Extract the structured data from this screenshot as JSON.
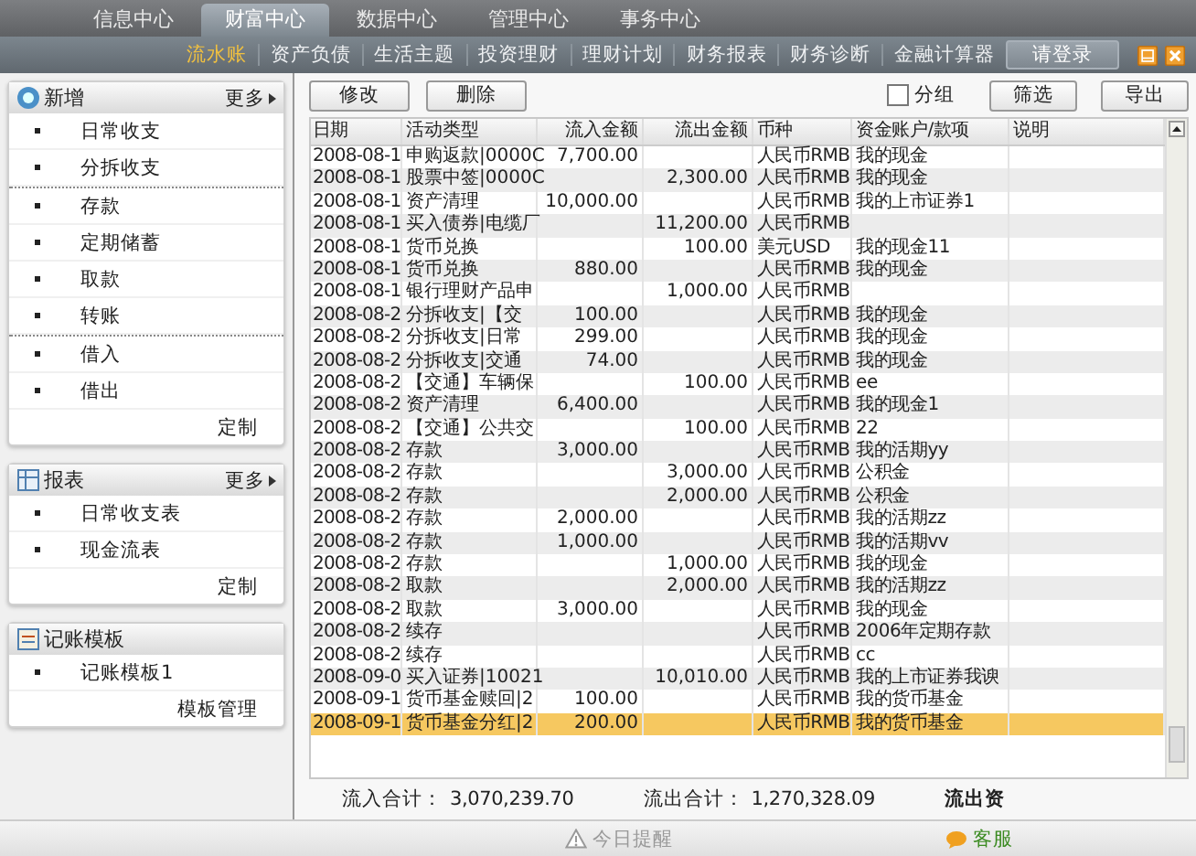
{
  "top_tabs": [
    {
      "label": "信息中心",
      "selected": false
    },
    {
      "label": "财富中心",
      "selected": true
    },
    {
      "label": "数据中心",
      "selected": false
    },
    {
      "label": "管理中心",
      "selected": false
    },
    {
      "label": "事务中心",
      "selected": false
    }
  ],
  "nav": [
    {
      "label": "流水账",
      "selected": true
    },
    {
      "label": "资产负债",
      "selected": false
    },
    {
      "label": "生活主题",
      "selected": false
    },
    {
      "label": "投资理财",
      "selected": false
    },
    {
      "label": "理财计划",
      "selected": false
    },
    {
      "label": "财务报表",
      "selected": false
    },
    {
      "label": "财务诊断",
      "selected": false
    },
    {
      "label": "金融计算器",
      "selected": false
    }
  ],
  "login_button": "请登录",
  "sidebar": [
    {
      "title": "新增",
      "more": "更多",
      "groups": [
        [
          "日常收支",
          "分拆收支"
        ],
        [
          "存款",
          "定期储蓄",
          "取款",
          "转账"
        ],
        [
          "借入",
          "借出"
        ]
      ],
      "footer": "定制"
    },
    {
      "title": "报表",
      "more": "更多",
      "groups": [
        [
          "日常收支表",
          "现金流表"
        ]
      ],
      "footer": "定制"
    },
    {
      "title": "记账模板",
      "groups": [
        [
          "记账模板1"
        ]
      ],
      "footer": "模板管理"
    }
  ],
  "toolbar": {
    "left_buttons": [
      "修改",
      "删除"
    ],
    "group_checkbox": {
      "label": "分组",
      "checked": false
    },
    "right_buttons": [
      "筛选",
      "导出"
    ]
  },
  "table": {
    "columns": [
      "日期",
      "活动类型",
      "流入金额",
      "流出金额",
      "币种",
      "资金账户/款项",
      "说明"
    ],
    "rows": [
      {
        "cells": [
          "2008-08-1",
          "申购返款|0000C",
          "7,700.00",
          "",
          "人民币RMB",
          "我的现金",
          ""
        ],
        "selected": false
      },
      {
        "cells": [
          "2008-08-1",
          "股票中签|0000C",
          "",
          "2,300.00",
          "人民币RMB",
          "我的现金",
          ""
        ],
        "selected": false
      },
      {
        "cells": [
          "2008-08-1",
          "资产清理",
          "10,000.00",
          "",
          "人民币RMB",
          "我的上市证券1",
          ""
        ],
        "selected": false
      },
      {
        "cells": [
          "2008-08-1",
          "买入债券|电缆厂",
          "",
          "11,200.00",
          "人民币RMB",
          "",
          ""
        ],
        "selected": false
      },
      {
        "cells": [
          "2008-08-1",
          "货币兑换",
          "",
          "100.00",
          "美元USD",
          "我的现金11",
          ""
        ],
        "selected": false
      },
      {
        "cells": [
          "2008-08-1",
          "货币兑换",
          "880.00",
          "",
          "人民币RMB",
          "我的现金",
          ""
        ],
        "selected": false
      },
      {
        "cells": [
          "2008-08-1",
          "银行理财产品申",
          "",
          "1,000.00",
          "人民币RMB",
          "",
          ""
        ],
        "selected": false
      },
      {
        "cells": [
          "2008-08-2",
          "分拆收支|【交",
          "100.00",
          "",
          "人民币RMB",
          "我的现金",
          ""
        ],
        "selected": false
      },
      {
        "cells": [
          "2008-08-2",
          "分拆收支|日常",
          "299.00",
          "",
          "人民币RMB",
          "我的现金",
          ""
        ],
        "selected": false
      },
      {
        "cells": [
          "2008-08-2",
          "分拆收支|交通",
          "74.00",
          "",
          "人民币RMB",
          "我的现金",
          ""
        ],
        "selected": false
      },
      {
        "cells": [
          "2008-08-2",
          "【交通】车辆保",
          "",
          "100.00",
          "人民币RMB",
          "ee",
          ""
        ],
        "selected": false
      },
      {
        "cells": [
          "2008-08-2",
          "资产清理",
          "6,400.00",
          "",
          "人民币RMB",
          "我的现金1",
          ""
        ],
        "selected": false
      },
      {
        "cells": [
          "2008-08-2",
          "【交通】公共交",
          "",
          "100.00",
          "人民币RMB",
          "22",
          ""
        ],
        "selected": false
      },
      {
        "cells": [
          "2008-08-2",
          "存款",
          "3,000.00",
          "",
          "人民币RMB",
          "我的活期yy",
          ""
        ],
        "selected": false
      },
      {
        "cells": [
          "2008-08-2",
          "存款",
          "",
          "3,000.00",
          "人民币RMB",
          "公积金",
          ""
        ],
        "selected": false
      },
      {
        "cells": [
          "2008-08-2",
          "存款",
          "",
          "2,000.00",
          "人民币RMB",
          "公积金",
          ""
        ],
        "selected": false
      },
      {
        "cells": [
          "2008-08-2",
          "存款",
          "2,000.00",
          "",
          "人民币RMB",
          "我的活期zz",
          ""
        ],
        "selected": false
      },
      {
        "cells": [
          "2008-08-2",
          "存款",
          "1,000.00",
          "",
          "人民币RMB",
          "我的活期vv",
          ""
        ],
        "selected": false
      },
      {
        "cells": [
          "2008-08-2",
          "存款",
          "",
          "1,000.00",
          "人民币RMB",
          "我的现金",
          ""
        ],
        "selected": false
      },
      {
        "cells": [
          "2008-08-2",
          "取款",
          "",
          "2,000.00",
          "人民币RMB",
          "我的活期zz",
          ""
        ],
        "selected": false
      },
      {
        "cells": [
          "2008-08-2",
          "取款",
          "3,000.00",
          "",
          "人民币RMB",
          "我的现金",
          ""
        ],
        "selected": false
      },
      {
        "cells": [
          "2008-08-2",
          "续存",
          "",
          "",
          "人民币RMB",
          "2006年定期存款",
          ""
        ],
        "selected": false
      },
      {
        "cells": [
          "2008-08-2",
          "续存",
          "",
          "",
          "人民币RMB",
          "cc",
          ""
        ],
        "selected": false
      },
      {
        "cells": [
          "2008-09-0",
          "买入证券|10021",
          "",
          "10,010.00",
          "人民币RMB",
          "我的上市证券我谀",
          ""
        ],
        "selected": false
      },
      {
        "cells": [
          "2008-09-1",
          "货币基金赎回|2",
          "100.00",
          "",
          "人民币RMB",
          "我的货币基金",
          ""
        ],
        "selected": false
      },
      {
        "cells": [
          "2008-09-1",
          "货币基金分红|2",
          "200.00",
          "",
          "人民币RMB",
          "我的货币基金",
          ""
        ],
        "selected": true
      }
    ]
  },
  "totals": [
    {
      "label": "流入合计：",
      "value": "3,070,239.70"
    },
    {
      "label": "流出合计：",
      "value": "1,270,328.09"
    }
  ],
  "totals_cut": "流出资",
  "footer": {
    "reminder": "今日提醒",
    "service": "客服"
  }
}
